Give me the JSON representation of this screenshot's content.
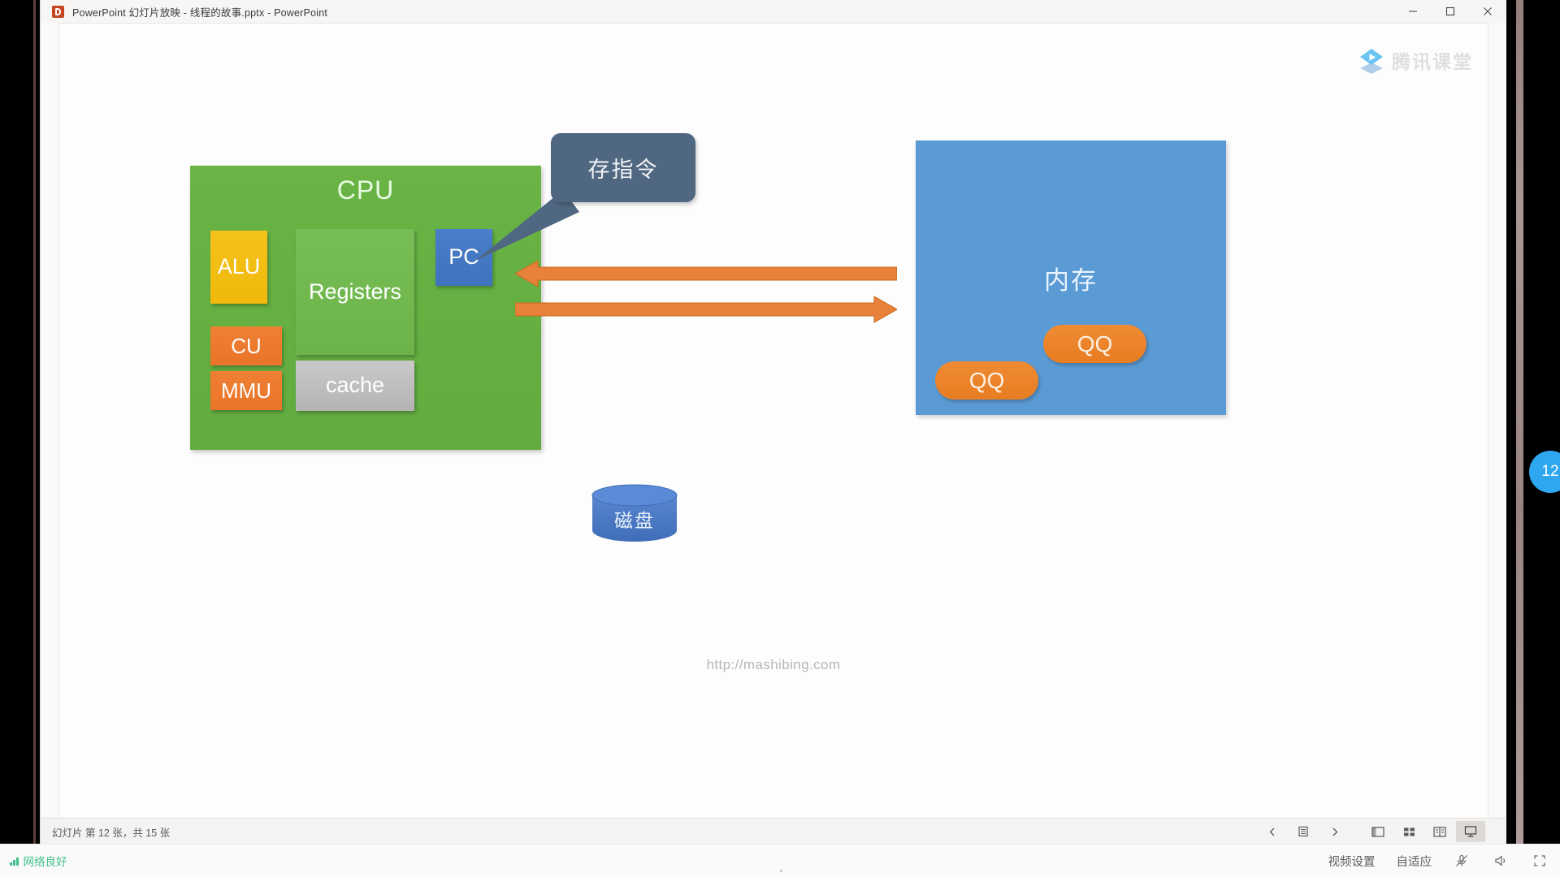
{
  "window": {
    "title": "PowerPoint 幻灯片放映  -  线程的故事.pptx - PowerPoint",
    "app_icon": "powerpoint-icon",
    "controls": {
      "minimize": "minimize-icon",
      "maximize": "maximize-icon",
      "close": "close-icon"
    }
  },
  "watermark": {
    "text": "腾讯课堂",
    "logo": "tencent-classroom-logo"
  },
  "slide": {
    "cpu": {
      "title": "CPU",
      "blocks": [
        {
          "id": "alu",
          "label": "ALU",
          "color": "#f0b90b"
        },
        {
          "id": "regs",
          "label": "Registers",
          "color": "#6cb44a"
        },
        {
          "id": "pc",
          "label": "PC",
          "color": "#3f72bd"
        },
        {
          "id": "cu",
          "label": "CU",
          "color": "#e9742a"
        },
        {
          "id": "mmu",
          "label": "MMU",
          "color": "#e9742a"
        },
        {
          "id": "cache",
          "label": "cache",
          "color": "#b4b4b4"
        }
      ],
      "box_color": "#62ac3f"
    },
    "callout": {
      "text": "存指令",
      "color": "#4f6780",
      "points_to": "pc"
    },
    "arrows": [
      {
        "id": "memory-to-cpu",
        "direction": "left",
        "color": "#e87d22"
      },
      {
        "id": "cpu-to-memory",
        "direction": "right",
        "color": "#e87d22"
      }
    ],
    "memory": {
      "label": "内存",
      "color": "#5b9bd5",
      "processes": [
        {
          "label": "QQ",
          "color": "#e87d22"
        },
        {
          "label": "QQ",
          "color": "#e87d22"
        }
      ]
    },
    "disk": {
      "label": "磁盘",
      "color": "#4472c4"
    },
    "footer_url": "http://mashibing.com"
  },
  "status_bar": {
    "slide_info": "幻灯片 第 12 张，共 15 张",
    "tools": [
      {
        "name": "previous-slide-button",
        "icon": "chevron-left-icon"
      },
      {
        "name": "speaker-notes-button",
        "icon": "notes-icon"
      },
      {
        "name": "next-slide-button",
        "icon": "chevron-right-icon"
      },
      {
        "name": "normal-view-button",
        "icon": "normal-view-icon"
      },
      {
        "name": "slide-sorter-button",
        "icon": "slide-sorter-icon"
      },
      {
        "name": "reading-view-button",
        "icon": "reading-view-icon"
      },
      {
        "name": "slideshow-button",
        "icon": "slideshow-icon"
      }
    ]
  },
  "side_badge": {
    "value": "12"
  },
  "app_bar": {
    "network": {
      "label": "网络良好",
      "icon": "signal-bars-icon",
      "color": "#3fc08a"
    },
    "video_settings": "视频设置",
    "fit_mode": "自适应",
    "icons": [
      {
        "name": "microphone-muted-icon"
      },
      {
        "name": "speaker-icon"
      },
      {
        "name": "fullscreen-icon"
      }
    ]
  }
}
